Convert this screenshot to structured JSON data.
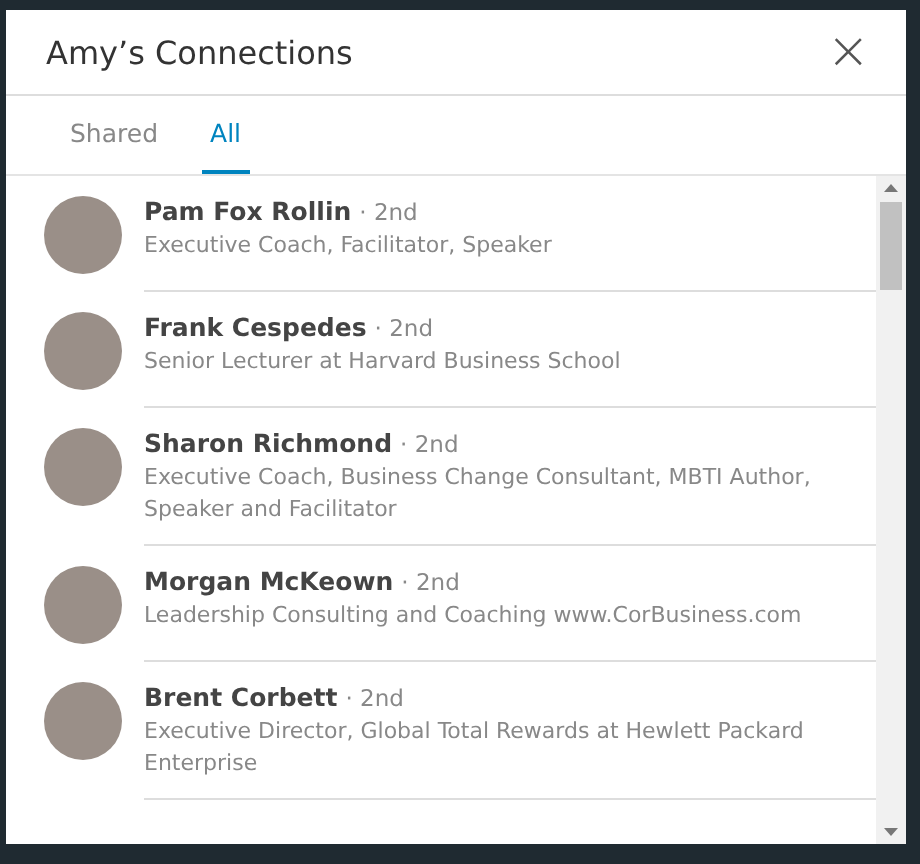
{
  "dialog": {
    "title": "Amy’s Connections",
    "close": "×"
  },
  "tabs": [
    {
      "label": "Shared",
      "selected": false
    },
    {
      "label": "All",
      "selected": true
    }
  ],
  "connections": [
    {
      "name": "Pam Fox Rollin",
      "degree": "· 2nd",
      "headline": "Executive Coach, Facilitator, Speaker"
    },
    {
      "name": "Frank Cespedes",
      "degree": "· 2nd",
      "headline": "Senior Lecturer at Harvard Business School"
    },
    {
      "name": "Sharon Richmond",
      "degree": "· 2nd",
      "headline": "Executive Coach, Business Change Consultant, MBTI Author, Speaker and Facilitator"
    },
    {
      "name": "Morgan McKeown",
      "degree": "· 2nd",
      "headline": "Leadership Consulting and Coaching www.CorBusiness.com"
    },
    {
      "name": "Brent Corbett",
      "degree": "· 2nd",
      "headline": "Executive Director, Global Total Rewards at Hewlett Packard Enterprise"
    }
  ]
}
